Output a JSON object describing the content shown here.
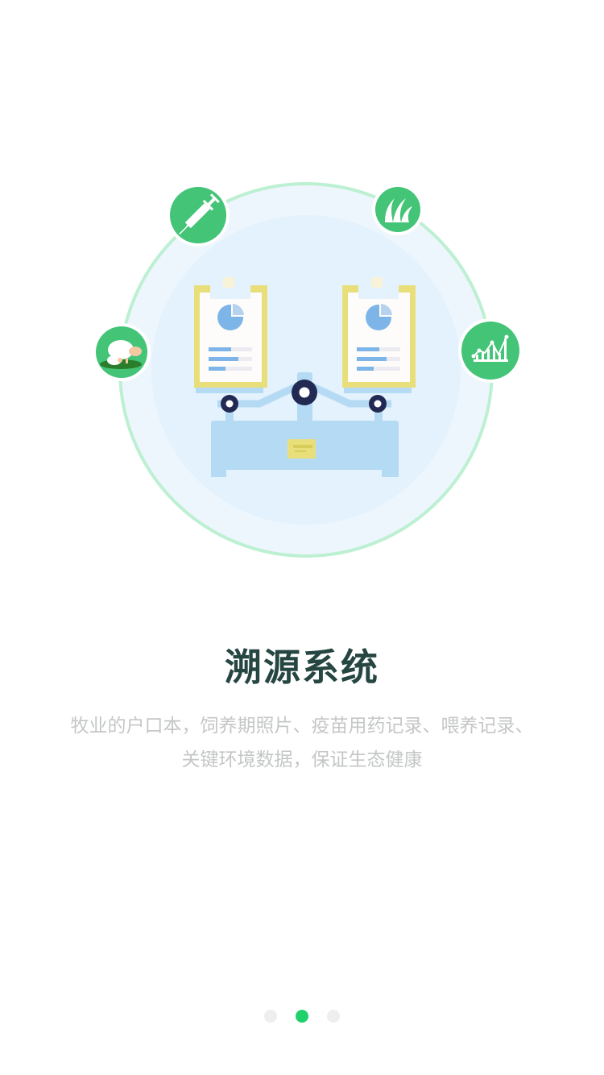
{
  "slide": {
    "title": "溯源系统",
    "description_line1": "牧业的户口本，饲养期照片、疫苗用药记录、喂养记录、",
    "description_line2": "关键环境数据，保证生态健康"
  },
  "pagination": {
    "total": 3,
    "active_index": 1
  },
  "icons": [
    "syringe-icon",
    "grass-icon",
    "sheep-icon",
    "growth-chart-icon",
    "balance-scale-illustration",
    "clipboard-icon"
  ],
  "colors": {
    "accent": "#43c477",
    "title": "#264641",
    "description": "#c4c7c6",
    "active_dot": "#1fd16b",
    "inactive_dot": "#eeeeee"
  }
}
